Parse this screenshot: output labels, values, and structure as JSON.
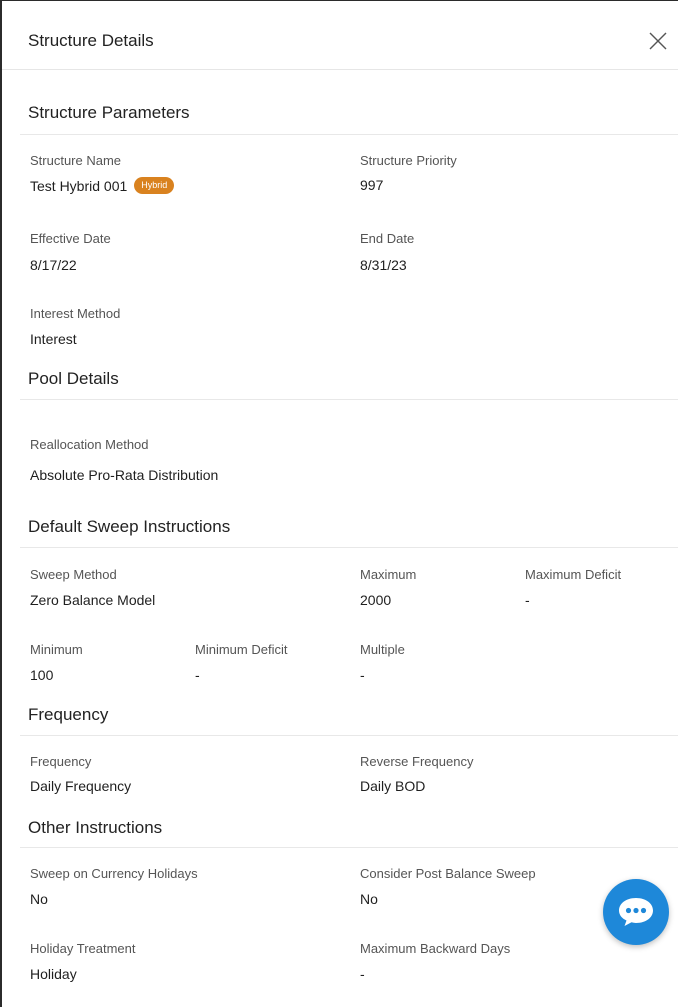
{
  "header": {
    "title": "Structure Details"
  },
  "sections": {
    "structure_parameters": {
      "title": "Structure Parameters",
      "structure_name": {
        "label": "Structure Name",
        "value": "Test Hybrid 001",
        "badge": "Hybrid"
      },
      "structure_priority": {
        "label": "Structure Priority",
        "value": "997"
      },
      "effective_date": {
        "label": "Effective Date",
        "value": "8/17/22"
      },
      "end_date": {
        "label": "End Date",
        "value": "8/31/23"
      },
      "interest_method": {
        "label": "Interest Method",
        "value": "Interest"
      }
    },
    "pool_details": {
      "title": "Pool Details",
      "reallocation_method": {
        "label": "Reallocation Method",
        "value": "Absolute Pro-Rata Distribution"
      }
    },
    "default_sweep": {
      "title": "Default Sweep Instructions",
      "sweep_method": {
        "label": "Sweep Method",
        "value": "Zero Balance Model"
      },
      "maximum": {
        "label": "Maximum",
        "value": "2000"
      },
      "maximum_deficit": {
        "label": "Maximum Deficit",
        "value": "-"
      },
      "minimum": {
        "label": "Minimum",
        "value": "100"
      },
      "minimum_deficit": {
        "label": "Minimum Deficit",
        "value": "-"
      },
      "multiple": {
        "label": "Multiple",
        "value": "-"
      }
    },
    "frequency": {
      "title": "Frequency",
      "frequency": {
        "label": "Frequency",
        "value": "Daily Frequency"
      },
      "reverse_frequency": {
        "label": "Reverse Frequency",
        "value": "Daily BOD"
      }
    },
    "other_instructions": {
      "title": "Other Instructions",
      "sweep_on_currency_holidays": {
        "label": "Sweep on Currency Holidays",
        "value": "No"
      },
      "consider_post_balance_sweep": {
        "label": "Consider Post Balance Sweep",
        "value": "No"
      },
      "holiday_treatment": {
        "label": "Holiday Treatment",
        "value": "Holiday"
      },
      "maximum_backward_days": {
        "label": "Maximum Backward Days",
        "value": "-"
      }
    }
  },
  "icons": {
    "close": "close-icon",
    "chat": "chat-bubble-icon"
  },
  "colors": {
    "badge": "#d9821f",
    "chat_button": "#1e88d9"
  }
}
